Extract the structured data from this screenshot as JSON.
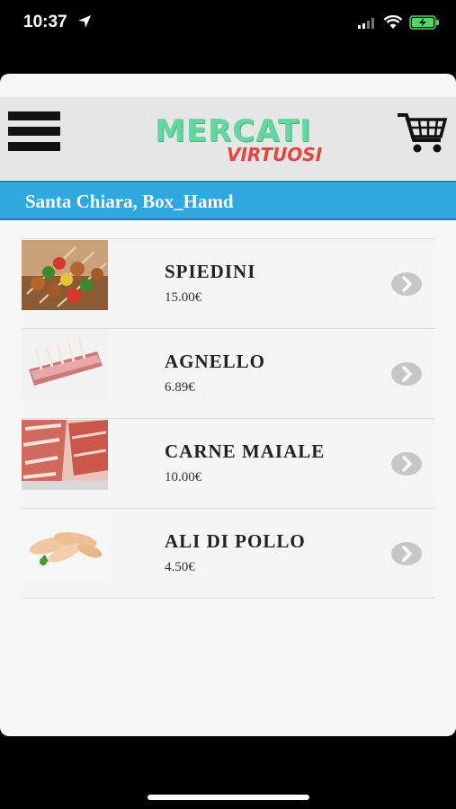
{
  "status_bar": {
    "time": "10:37"
  },
  "header": {
    "logo_main": "MERCATI",
    "logo_sub": "VIRTUOSI"
  },
  "location": {
    "label": "Santa Chiara, Box_Hamd"
  },
  "products": [
    {
      "name": "SPIEDINI",
      "price": "15.00€",
      "image": "skewers-image"
    },
    {
      "name": "AGNELLO",
      "price": "6.89€",
      "image": "lamb-rack-image"
    },
    {
      "name": "CARNE MAIALE",
      "price": "10.00€",
      "image": "pork-meat-image"
    },
    {
      "name": "ALI DI POLLO",
      "price": "4.50€",
      "image": "chicken-wings-image"
    }
  ],
  "colors": {
    "accent": "#2ea8df",
    "logo_green": "#66d6a0",
    "logo_red": "#e8433f"
  }
}
